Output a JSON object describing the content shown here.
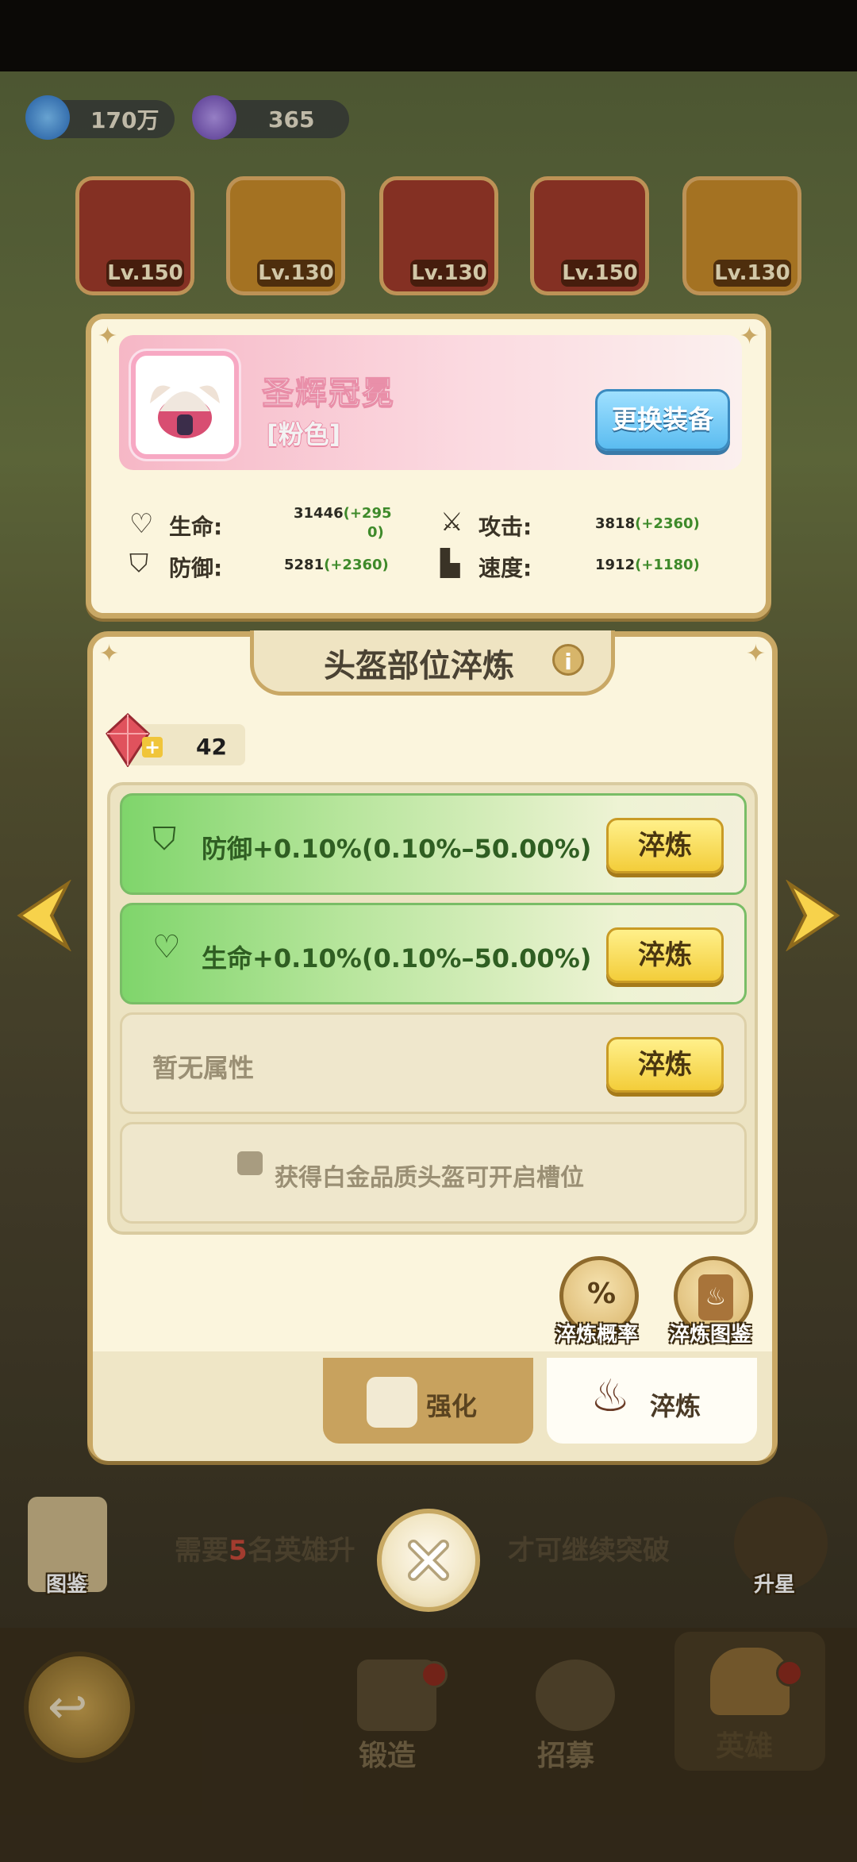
{
  "resources": {
    "gold": "170万",
    "gems": "365"
  },
  "heroes": [
    {
      "level": "Lv.150",
      "color": "#a23b2b"
    },
    {
      "level": "Lv.130",
      "color": "#c98c2a"
    },
    {
      "level": "Lv.130",
      "color": "#a23b2b"
    },
    {
      "level": "Lv.150",
      "color": "#a23b2b"
    },
    {
      "level": "Lv.130",
      "color": "#c98c2a"
    }
  ],
  "equipment": {
    "name": "圣辉冠冕",
    "quality": "[粉色]",
    "change_button": "更换装备",
    "stats": {
      "hp_label": "生命:",
      "hp_base": "31446",
      "hp_bonus_line1": "(+295",
      "hp_bonus_line2": "0)",
      "atk_label": "攻击:",
      "atk_base": "3818",
      "atk_bonus": "(+2360)",
      "def_label": "防御:",
      "def_base": "5281",
      "def_bonus": "(+2360)",
      "spd_label": "速度:",
      "spd_base": "1912",
      "spd_bonus": "(+1180)"
    }
  },
  "refine": {
    "title": "头盔部位淬炼",
    "info": "i",
    "gem_count": "42",
    "slots": [
      {
        "text": "防御+0.10%(0.10%–50.00%)",
        "button": "淬炼",
        "icon": "shield-icon"
      },
      {
        "text": "生命+0.10%(0.10%–50.00%)",
        "button": "淬炼",
        "icon": "heart-icon"
      },
      {
        "text": "暂无属性",
        "button": "淬炼"
      }
    ],
    "locked_slot": "获得白金品质头盔可开启槽位",
    "rate_button": "淬炼概率",
    "codex_button": "淬炼图鉴",
    "rate_icon": "%",
    "tabs": {
      "strengthen": "强化",
      "refine": "淬炼"
    }
  },
  "background": {
    "codex_label": "图鉴",
    "notice_prefix": "需要",
    "notice_number": "5",
    "notice_mid": "名英雄升",
    "notice_suffix": "才可继续突破",
    "upstar_label": "升星"
  },
  "nav": {
    "forge": "锻造",
    "recruit": "招募",
    "hero": "英雄"
  }
}
